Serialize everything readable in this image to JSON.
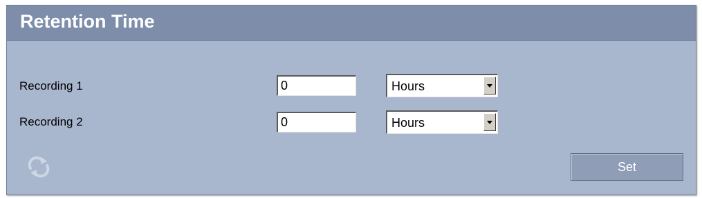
{
  "header": {
    "title": "Retention Time"
  },
  "rows": [
    {
      "label": "Recording 1",
      "value": "0",
      "unit": "Hours"
    },
    {
      "label": "Recording 2",
      "value": "0",
      "unit": "Hours"
    }
  ],
  "actions": {
    "set_label": "Set"
  },
  "icons": {
    "refresh": "refresh-icon"
  },
  "colors": {
    "panel_bg": "#a9b7ce",
    "titlebar_bg": "#7d8daa",
    "button_bg": "#8f9eb6"
  }
}
